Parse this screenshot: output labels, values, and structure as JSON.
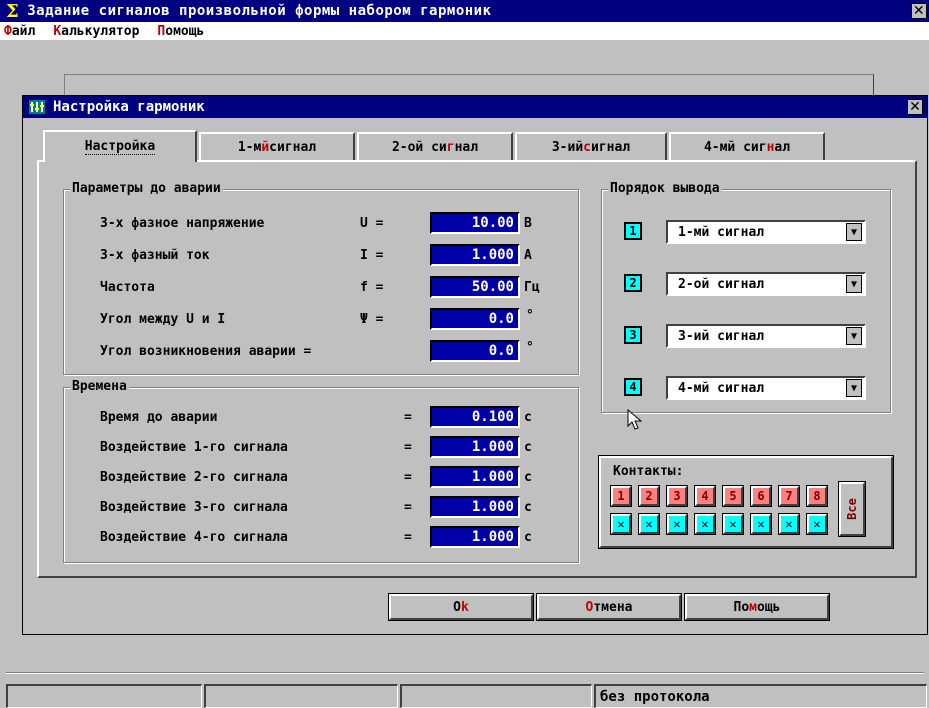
{
  "main_window": {
    "title": "Задание сигналов произвольной формы набором гармоник",
    "close_glyph": "✕",
    "menu": [
      {
        "hot": "Ф",
        "rest": "айл"
      },
      {
        "hot": "К",
        "rest": "алькулятор"
      },
      {
        "hot": "П",
        "rest": "омощь"
      }
    ]
  },
  "dialog": {
    "title": "Настройка гармоник",
    "close_glyph": "✕",
    "tabs": [
      {
        "a": "Настройка",
        "hot": "",
        "b": ""
      },
      {
        "a": "1-м",
        "hot": "й",
        "b": " сигнал"
      },
      {
        "a": "2-ой си",
        "hot": "г",
        "b": "нал"
      },
      {
        "a": "3-ий ",
        "hot": "с",
        "b": "игнал"
      },
      {
        "a": "4-мй сиг",
        "hot": "н",
        "b": "ал"
      }
    ],
    "params_group": {
      "title": "Параметры до аварии",
      "rows": [
        {
          "label": "3-х фазное напряжение",
          "sym": "U =",
          "value": "10.00",
          "unit": "В"
        },
        {
          "label": "3-х фазный ток",
          "sym": "I =",
          "value": "1.000",
          "unit": "А"
        },
        {
          "label": "Частота",
          "sym": "f =",
          "value": "50.00",
          "unit": "Гц"
        },
        {
          "label": "Угол между U и I",
          "sym": "Ψ =",
          "value": "0.0",
          "unit": "°"
        },
        {
          "label": "Угол возникновения аварии =",
          "sym": "",
          "value": "0.0",
          "unit": "°"
        }
      ]
    },
    "times_group": {
      "title": "Времена",
      "rows": [
        {
          "label": "Время до аварии",
          "sym": "=",
          "value": "0.100",
          "unit": "с"
        },
        {
          "label": "Воздействие 1-го сигнала",
          "sym": "=",
          "value": "1.000",
          "unit": "с"
        },
        {
          "label": "Воздействие 2-го сигнала",
          "sym": "=",
          "value": "1.000",
          "unit": "с"
        },
        {
          "label": "Воздействие 3-го сигнала",
          "sym": "=",
          "value": "1.000",
          "unit": "с"
        },
        {
          "label": "Воздействие 4-го сигнала",
          "sym": "=",
          "value": "1.000",
          "unit": "с"
        }
      ]
    },
    "order_group": {
      "title": "Порядок вывода",
      "rows": [
        {
          "index": "1",
          "value": "1-мй сигнал"
        },
        {
          "index": "2",
          "value": "2-ой сигнал"
        },
        {
          "index": "3",
          "value": "3-ий сигнал"
        },
        {
          "index": "4",
          "value": "4-мй сигнал"
        }
      ],
      "arrow_glyph": "▼"
    },
    "contacts": {
      "title": "Контакты:",
      "numbers": [
        "1",
        "2",
        "3",
        "4",
        "5",
        "6",
        "7",
        "8"
      ],
      "x_glyph": "✕",
      "all_label": "Все"
    },
    "buttons": {
      "ok": {
        "a": "O",
        "hot": "k",
        "b": ""
      },
      "cancel": {
        "a": "",
        "hot": "О",
        "b": "тмена"
      },
      "help": {
        "a": "По",
        "hot": "м",
        "b": "ощь"
      }
    }
  },
  "status_bar": {
    "cells": [
      "",
      "",
      "",
      "без протокола"
    ]
  },
  "colors": {
    "title_bar": "#000080",
    "face": "#c0c0c0",
    "value_field": "#0000a8",
    "hotkey": "#c00000",
    "index_box": "#00ffff",
    "contact_button": "#ff8080"
  }
}
